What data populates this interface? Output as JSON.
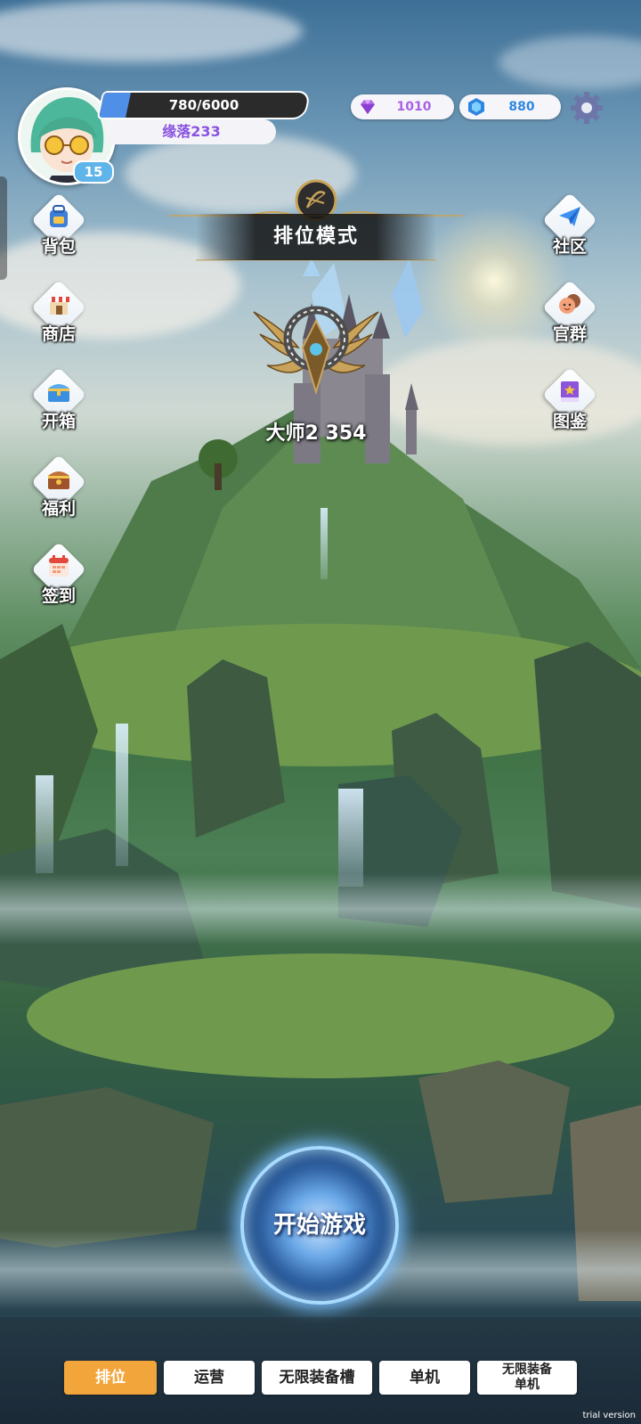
{
  "player": {
    "xp_text": "780/6000",
    "xp_progress": 0.13,
    "name": "缘落233",
    "level": "15"
  },
  "currencies": {
    "gems": {
      "value": "1010",
      "icon": "purple-diamond-icon",
      "color": "#a861e8"
    },
    "crystals": {
      "value": "880",
      "icon": "blue-hexagon-crystal-icon",
      "color": "#2f86e0"
    }
  },
  "left_menu": [
    {
      "label": "背包",
      "icon": "backpack-icon"
    },
    {
      "label": "商店",
      "icon": "shop-icon"
    },
    {
      "label": "开箱",
      "icon": "chest-icon"
    },
    {
      "label": "福利",
      "icon": "gift-chest-icon"
    },
    {
      "label": "签到",
      "icon": "calendar-icon"
    }
  ],
  "right_menu": [
    {
      "label": "社区",
      "icon": "paper-plane-icon"
    },
    {
      "label": "官群",
      "icon": "group-chat-icon"
    },
    {
      "label": "图鉴",
      "icon": "book-icon"
    }
  ],
  "rank": {
    "mode_title": "排位模式",
    "rank_text": "大师2 354"
  },
  "start_button": {
    "label": "开始游戏"
  },
  "tabs": [
    {
      "label": "排位",
      "active": true
    },
    {
      "label": "运营",
      "active": false
    },
    {
      "label": "无限装备槽",
      "active": false
    },
    {
      "label": "单机",
      "active": false
    },
    {
      "label_line1": "无限装备",
      "label_line2": "单机",
      "active": false
    }
  ],
  "watermark": "trial version",
  "colors": {
    "accent_tab": "#f2a53a",
    "name_text": "#8a53e0",
    "level_badge": "#5fb4ea"
  }
}
